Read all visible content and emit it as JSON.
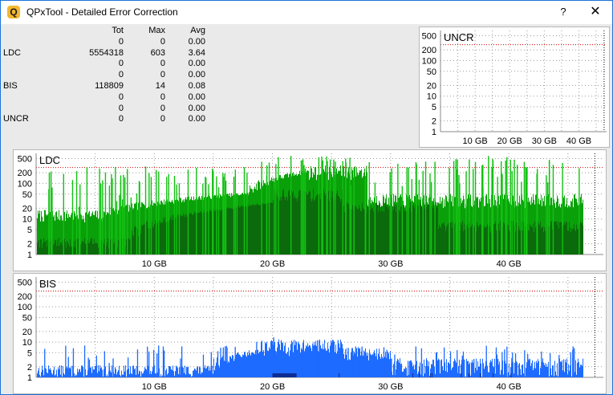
{
  "window": {
    "title": "QPxTool - Detailed Error Correction",
    "app_icon_letter": "Q",
    "help_glyph": "?",
    "close_glyph": "✕"
  },
  "stats": {
    "headers": {
      "tot": "Tot",
      "max": "Max",
      "avg": "Avg"
    },
    "rows": [
      {
        "label": "",
        "tot": "0",
        "max": "0",
        "avg": "0.00"
      },
      {
        "label": "LDC",
        "tot": "5554318",
        "max": "603",
        "avg": "3.64"
      },
      {
        "label": "",
        "tot": "0",
        "max": "0",
        "avg": "0.00"
      },
      {
        "label": "",
        "tot": "0",
        "max": "0",
        "avg": "0.00"
      },
      {
        "label": "BIS",
        "tot": "118809",
        "max": "14",
        "avg": "0.08"
      },
      {
        "label": "",
        "tot": "0",
        "max": "0",
        "avg": "0.00"
      },
      {
        "label": "",
        "tot": "0",
        "max": "0",
        "avg": "0.00"
      },
      {
        "label": "UNCR",
        "tot": "0",
        "max": "0",
        "avg": "0.00"
      }
    ]
  },
  "chart_data": [
    {
      "type": "bar",
      "title": "UNCR",
      "y_scale": "log",
      "y_ticks": [
        "500",
        "200",
        "100",
        "50",
        "20",
        "10",
        "5",
        "2",
        "1"
      ],
      "x_ticks": [
        "10 GB",
        "20 GB",
        "30 GB",
        "40 GB"
      ],
      "x_range_gb": [
        0,
        48
      ],
      "threshold": 280,
      "series": [],
      "grid": true,
      "colors": {
        "threshold": "#cc0000",
        "grid": "#9a9a9a"
      }
    },
    {
      "type": "bar",
      "title": "LDC",
      "y_scale": "log",
      "y_ticks": [
        "500",
        "200",
        "100",
        "50",
        "20",
        "10",
        "5",
        "2",
        "1"
      ],
      "x_ticks": [
        "10 GB",
        "20 GB",
        "30 GB",
        "40 GB"
      ],
      "x_range_gb": [
        0,
        48
      ],
      "data_end_gb": 46.3,
      "threshold": 280,
      "peak": 603,
      "grid": true,
      "colors": {
        "light": "#12c012",
        "mid": "#0aa00a",
        "dark": "#0b6a0b",
        "threshold": "#cc0000",
        "grid": "#9a9a9a"
      }
    },
    {
      "type": "bar",
      "title": "BIS",
      "y_scale": "log",
      "y_ticks": [
        "500",
        "200",
        "100",
        "50",
        "20",
        "10",
        "5",
        "2",
        "1"
      ],
      "x_ticks": [
        "10 GB",
        "20 GB",
        "30 GB",
        "40 GB"
      ],
      "x_range_gb": [
        0,
        48
      ],
      "data_end_gb": 46.3,
      "threshold": 280,
      "peak": 14,
      "grid": true,
      "colors": {
        "light": "#1e6bff",
        "dark": "#0b2a8a",
        "threshold": "#cc0000",
        "grid": "#9a9a9a"
      }
    }
  ]
}
